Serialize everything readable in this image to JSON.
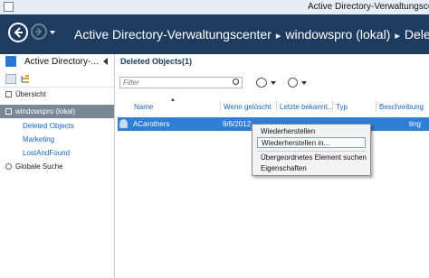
{
  "window": {
    "title": "Active Directory-Verwaltungscenter"
  },
  "header": {
    "breadcrumb": [
      "Active Directory-Verwaltungscenter",
      "windowspro (lokal)",
      "Dele"
    ]
  },
  "left_pane": {
    "title": "Active Directory-...",
    "items": [
      {
        "label": "Übersicht"
      },
      {
        "label": "windowspro (lokal)",
        "selected": true
      },
      {
        "label": "Deleted Objects"
      },
      {
        "label": "Marketing"
      },
      {
        "label": "LostAndFound"
      },
      {
        "label": "Globale Suche"
      }
    ]
  },
  "content": {
    "section_title": "Deleted Objects",
    "count": "(1)",
    "filter_placeholder": "Filter",
    "columns": [
      "Name",
      "Wenn gelöscht",
      "Letzte bekannt...",
      "Typ",
      "Beschreibung"
    ],
    "rows": [
      {
        "name": "ACarothers",
        "when_deleted": "9/6/2012",
        "description_tail": "ting"
      }
    ]
  },
  "context_menu": {
    "items": [
      "Wiederherstellen",
      "Wiederherstellen in...",
      "Übergeordnetes Element suchen",
      "Eigenschaften"
    ],
    "highlighted_index": 1
  },
  "colors": {
    "nav_bar": "#1f3c60",
    "selection": "#2f7fd6",
    "link": "#1565c0",
    "selected_nav": "#7a8796"
  }
}
